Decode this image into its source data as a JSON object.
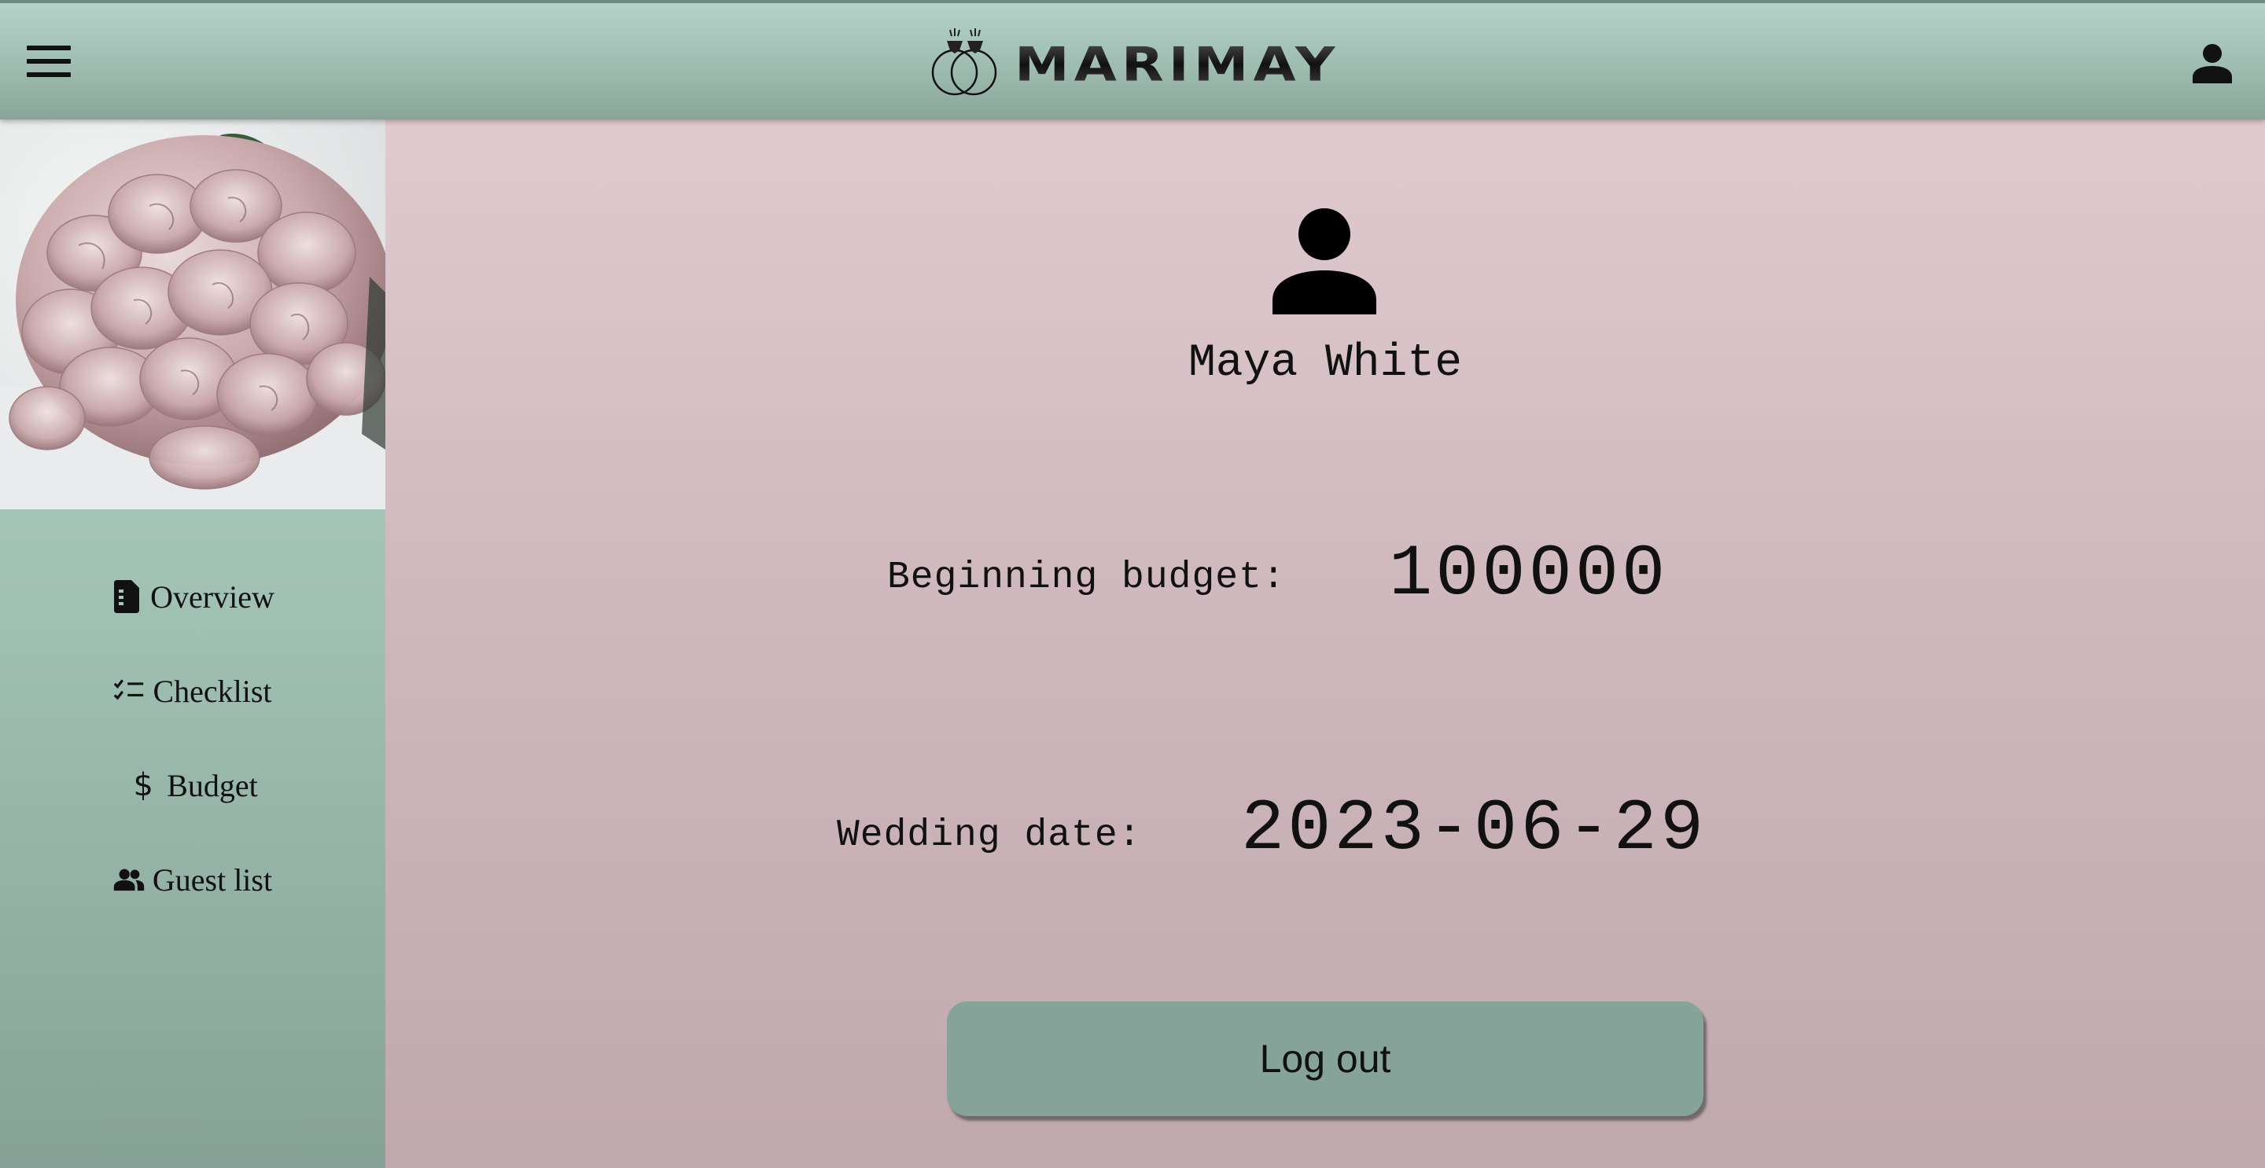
{
  "header": {
    "logo_text": "MARIMAY",
    "menu_icon": "hamburger-menu-icon",
    "account_icon": "user-account-icon"
  },
  "sidebar": {
    "hero_image": "pink hydrangea flowers",
    "items": [
      {
        "label": "Overview",
        "icon": "document-icon"
      },
      {
        "label": "Checklist",
        "icon": "checklist-icon"
      },
      {
        "label": "Budget",
        "icon": "dollar-icon"
      },
      {
        "label": "Guest list",
        "icon": "people-icon"
      }
    ]
  },
  "profile": {
    "name": "Maya White",
    "budget_label": "Beginning budget:",
    "budget_value": "100000",
    "date_label": "Wedding date:",
    "date_value": "2023-06-29",
    "logout_label": "Log out"
  },
  "colors": {
    "header_green": "#9ebcb0",
    "main_pink": "#d4bfc4",
    "button_green": "#85a398"
  }
}
